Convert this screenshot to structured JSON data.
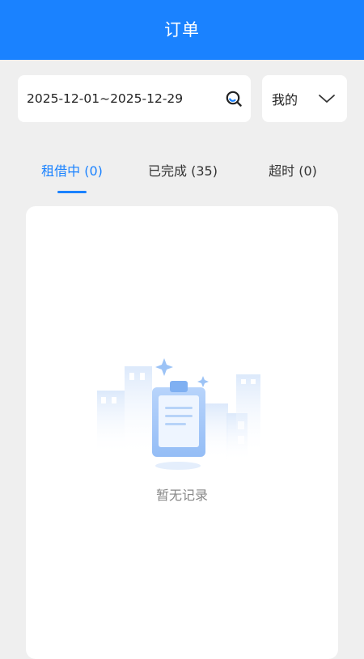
{
  "header": {
    "title": "订单"
  },
  "filters": {
    "date_range": "2025-12-01~2025-12-29",
    "scope_select": "我的"
  },
  "tabs": [
    {
      "label": "租借中 (0)",
      "active": true
    },
    {
      "label": "已完成 (35)",
      "active": false
    },
    {
      "label": "超时 (0)",
      "active": false
    }
  ],
  "empty_state": {
    "message": "暂无记录"
  },
  "colors": {
    "accent": "#1a82ff",
    "background": "#efefef"
  },
  "icons": {
    "search": "search-icon",
    "dropdown": "chevron-down-icon",
    "empty": "clipboard-illustration"
  }
}
